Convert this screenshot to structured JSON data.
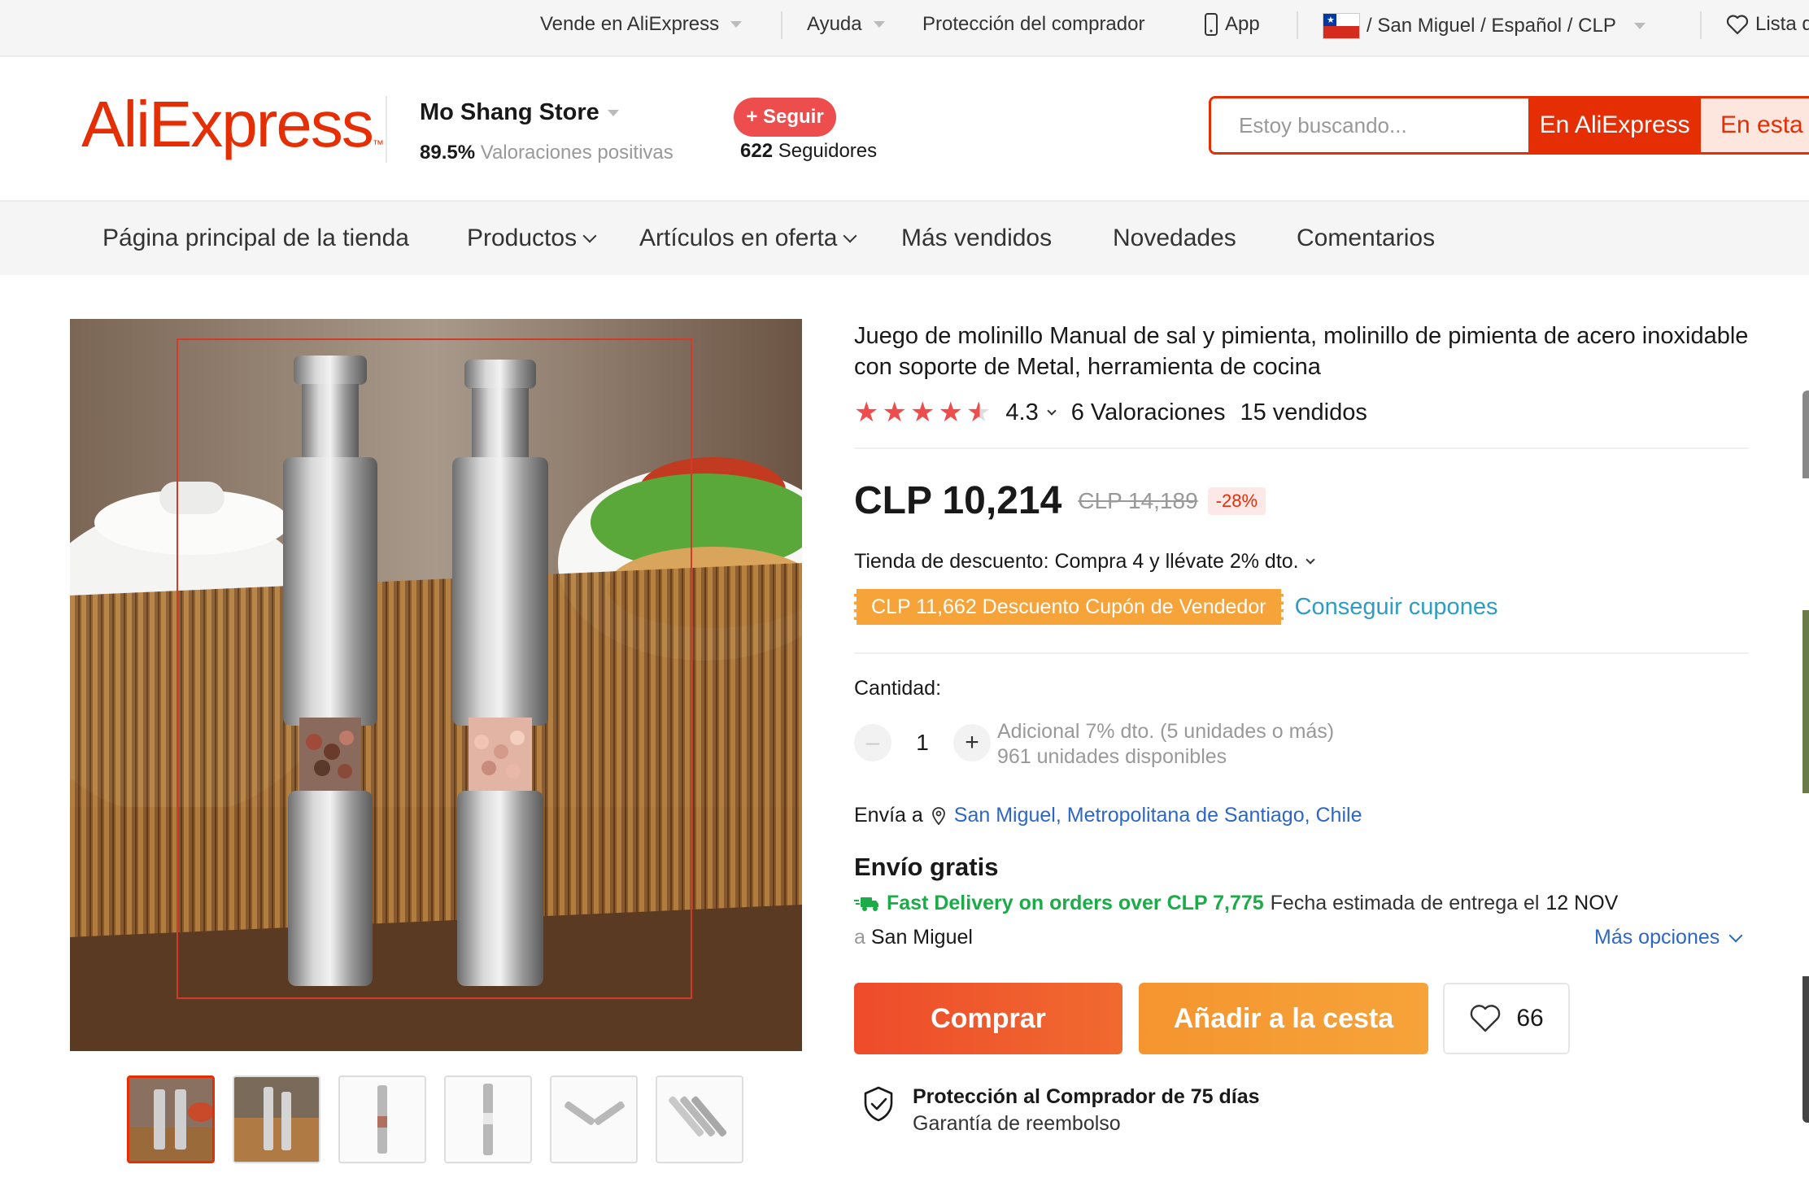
{
  "topbar": {
    "sell": "Vende en AliExpress",
    "help": "Ayuda",
    "buyer_protection": "Protección del comprador",
    "app": "App",
    "locale": "/ San Miguel / Español /  CLP",
    "wishlist": "Lista de Deseos"
  },
  "header": {
    "logo": "AliExpress",
    "store_name": "Mo Shang Store",
    "positive_pct": "89.5%",
    "positive_label": "Valoraciones positivas",
    "follow_label": "+ Seguir",
    "followers_count": "622",
    "followers_label": "Seguidores",
    "search_placeholder": "Estoy buscando...",
    "search_ae_label": "En AliExpress",
    "search_store_label": "En esta tienda"
  },
  "storenav": {
    "home": "Página principal de la tienda",
    "products": "Productos",
    "offers": "Artículos en oferta",
    "bestsellers": "Más vendidos",
    "new": "Novedades",
    "reviews": "Comentarios"
  },
  "product": {
    "title": "Juego de molinillo Manual de sal y pimienta, molinillo de pimienta de acero inoxidable con soporte de Metal, herramienta de cocina",
    "rating_value": "4.3",
    "rating_stars": 4.5,
    "reviews": "6 Valoraciones",
    "sold": "15 vendidos",
    "price": "CLP 10,214",
    "old_price": "CLP 14,189",
    "discount": "-28%",
    "store_discount": "Tienda de descuento: Compra 4 y llévate 2% dto.",
    "coupon": "CLP 11,662 Descuento Cupón de Vendedor",
    "get_coupons": "Conseguir cupones",
    "quantity_label": "Cantidad:",
    "quantity": "1",
    "extra_discount": "Adicional 7% dto. (5 unidades o más)",
    "stock": "961 unidades disponibles",
    "ship_to_label": "Envía a",
    "ship_location": "San Miguel, Metropolitana de Santiago, Chile",
    "free_shipping": "Envío gratis",
    "fast_delivery": "Fast Delivery on orders over CLP 7,775",
    "estimate_label": "Fecha estimada de entrega el",
    "estimate_date": "12 NOV",
    "to_prefix": "a",
    "to_town": "San Miguel",
    "more_options": "Más opciones",
    "buy_label": "Comprar",
    "cart_label": "Añadir a la cesta",
    "wishlist_count": "66",
    "protection_title": "Protección al Comprador de 75 días",
    "protection_sub": "Garantía de reembolso"
  },
  "colors": {
    "brand": "#e62e04",
    "coupon": "#f6a33a",
    "link": "#2d67c5",
    "fast_delivery": "#1bab48"
  }
}
